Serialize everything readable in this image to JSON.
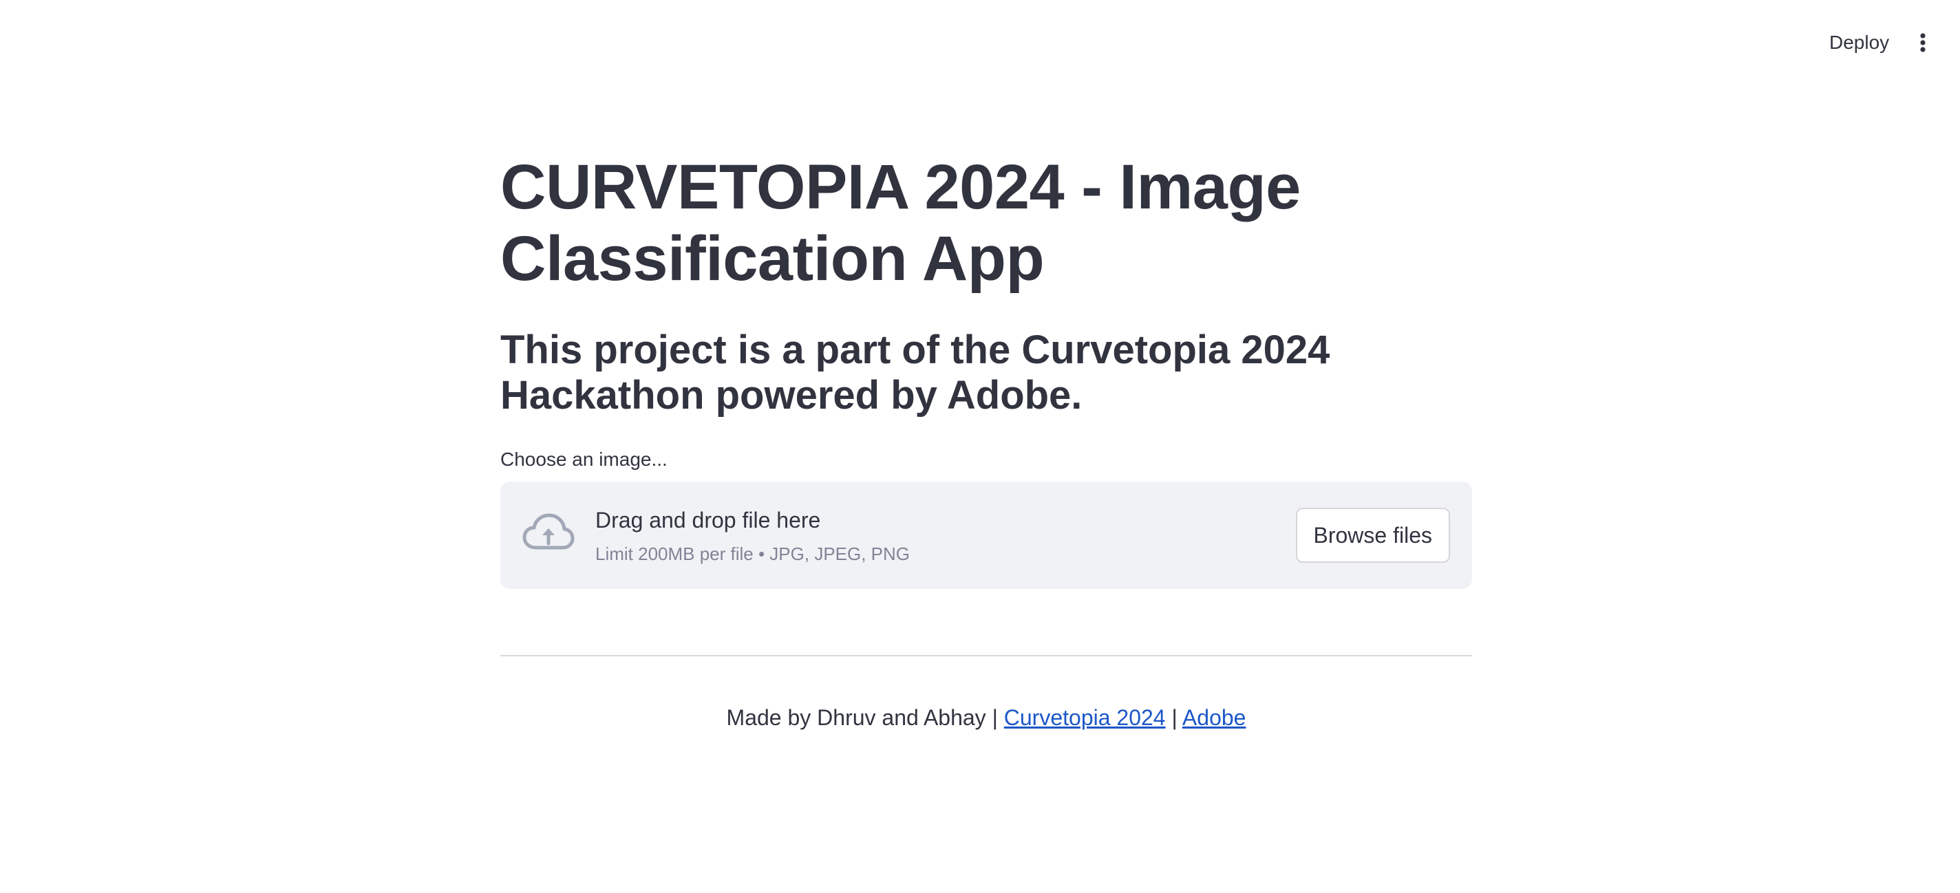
{
  "header": {
    "deploy_label": "Deploy",
    "menu_icon": "vertical-ellipsis-icon"
  },
  "main": {
    "title": "CURVETOPIA 2024 - Image Classification App",
    "subtitle": "This project is a part of the Curvetopia 2024 Hackathon powered by Adobe.",
    "uploader": {
      "label": "Choose an image...",
      "icon": "cloud-upload-icon",
      "drop_text": "Drag and drop file here",
      "limit_text": "Limit 200MB per file • JPG, JPEG, PNG",
      "browse_label": "Browse files"
    },
    "footer": {
      "prefix": "Made by Dhruv and Abhay",
      "separator": " | ",
      "link1": "Curvetopia 2024",
      "link2": "Adobe"
    }
  },
  "colors": {
    "text": "#31333f",
    "dropzone_bg": "#f0f2f6",
    "muted": "#808495",
    "link": "#1c57c8",
    "icon": "#a3a8b8"
  }
}
